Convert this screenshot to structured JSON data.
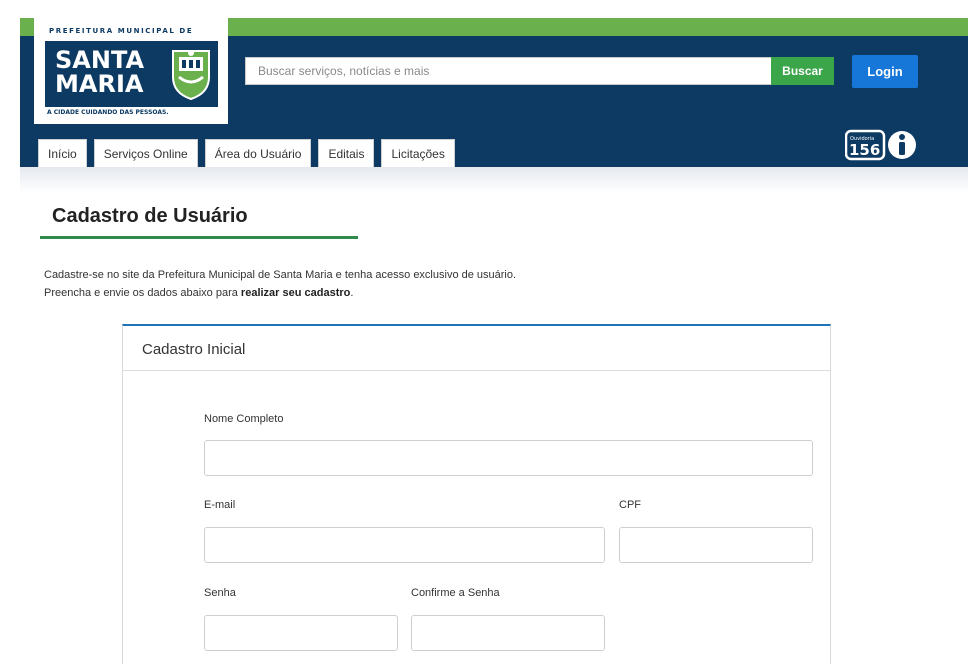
{
  "header": {
    "logo": {
      "top_text": "PREFEITURA MUNICIPAL DE",
      "word1": "SANTA",
      "word2": "MARIA",
      "tagline": "A CIDADE CUIDANDO DAS PESSOAS."
    },
    "search": {
      "placeholder": "Buscar serviços, notícias e mais",
      "button_label": "Buscar"
    },
    "login_label": "Login",
    "tabs": [
      {
        "label": "Início"
      },
      {
        "label": "Serviços Online"
      },
      {
        "label": "Área do Usuário"
      },
      {
        "label": "Editais"
      },
      {
        "label": "Licitações"
      }
    ],
    "ouvidoria": {
      "small_text": "Ouvidoria",
      "number": "156"
    },
    "colors": {
      "navy": "#0d3a63",
      "green": "#6ab04c",
      "search_button": "#3ba54a",
      "login_button": "#1677d9"
    }
  },
  "main": {
    "title": "Cadastro de Usuário",
    "intro_line1": "Cadastre-se no site da Prefeitura Municipal de Santa Maria e tenha acesso exclusivo de usuário.",
    "intro_line2_prefix": "Preencha e envie os dados abaixo para ",
    "intro_line2_bold": "realizar seu cadastro",
    "intro_line2_suffix": ".",
    "card": {
      "title": "Cadastro Inicial",
      "fields": {
        "nome": {
          "label": "Nome Completo",
          "value": ""
        },
        "email": {
          "label": "E-mail",
          "value": ""
        },
        "cpf": {
          "label": "CPF",
          "value": ""
        },
        "senha": {
          "label": "Senha",
          "value": ""
        },
        "confirme": {
          "label": "Confirme a Senha",
          "value": ""
        }
      }
    }
  }
}
